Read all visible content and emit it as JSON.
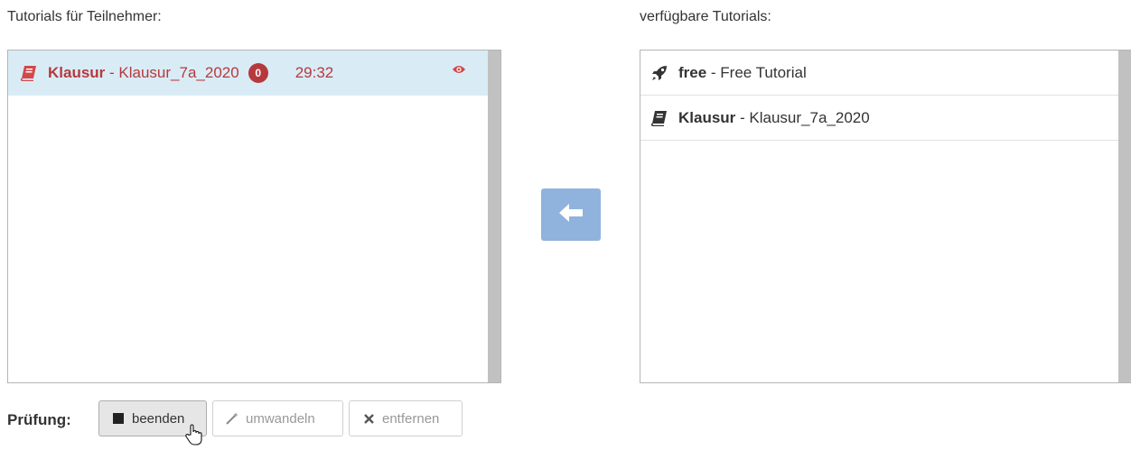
{
  "left_panel": {
    "heading": "Tutorials für Teilnehmer:",
    "items": [
      {
        "name": "Klausur",
        "separator": " - ",
        "detail": "Klausur_7a_2020",
        "badge": "0",
        "time": "29:32",
        "icon": "book-icon",
        "status_icon": "eye-icon"
      }
    ]
  },
  "right_panel": {
    "heading": "verfügbare Tutorials:",
    "items": [
      {
        "name": "free",
        "separator": " - ",
        "detail": "Free Tutorial",
        "icon": "rocket-icon"
      },
      {
        "name": "Klausur",
        "separator": " - ",
        "detail": "Klausur_7a_2020",
        "icon": "book-icon"
      }
    ]
  },
  "move_button": {
    "icon": "arrow-left-icon"
  },
  "exam_bar": {
    "label": "Prüfung:",
    "buttons": [
      {
        "label": "beenden",
        "icon": "stop-icon",
        "state": "active"
      },
      {
        "label": "umwandeln",
        "icon": "magic-wand-icon",
        "state": "disabled"
      },
      {
        "label": "entfernen",
        "icon": "times-icon",
        "state": "disabled"
      }
    ]
  },
  "colors": {
    "accent_red": "#b6393c",
    "selected_bg": "#d9ecf6",
    "move_button": "#8fb3dc"
  }
}
